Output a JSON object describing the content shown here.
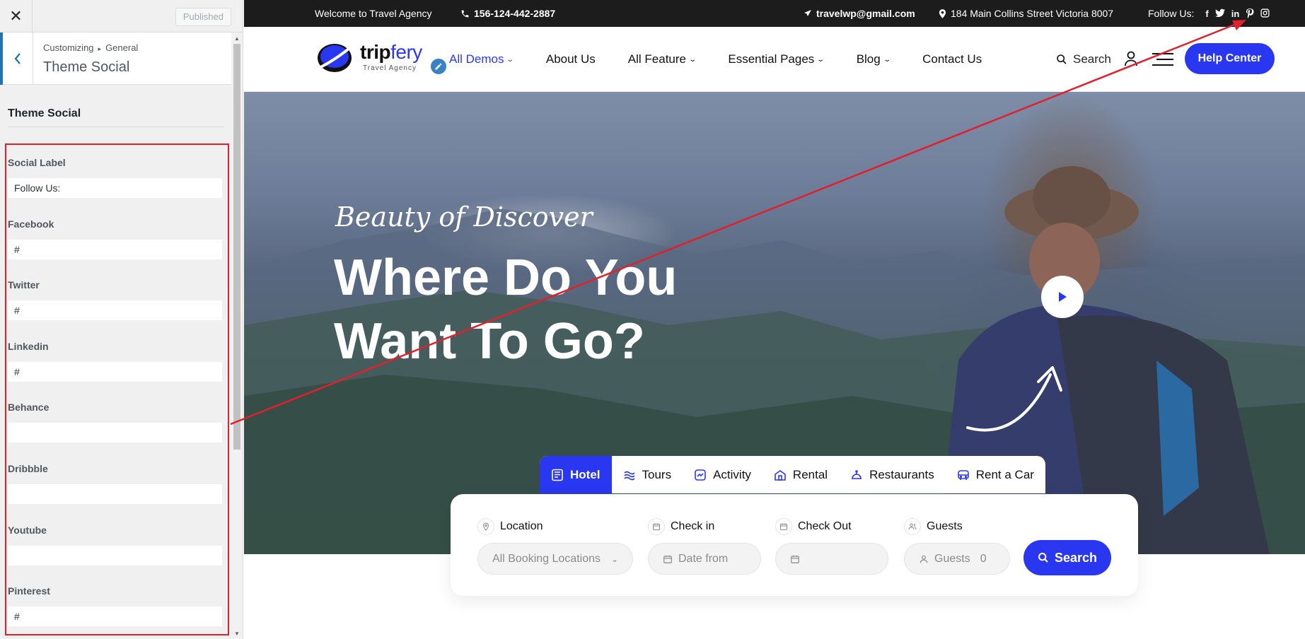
{
  "customizer": {
    "close_label": "✕",
    "published_label": "Published",
    "breadcrumb_root": "Customizing",
    "breadcrumb_sep": "▸",
    "breadcrumb_parent": "General",
    "section_title": "Theme Social",
    "panel_heading": "Theme Social",
    "fields": [
      {
        "label": "Social Label",
        "value": "Follow Us:"
      },
      {
        "label": "Facebook",
        "value": "#"
      },
      {
        "label": "Twitter",
        "value": "#"
      },
      {
        "label": "Linkedin",
        "value": "#"
      },
      {
        "label": "Behance",
        "value": ""
      },
      {
        "label": "Dribbble",
        "value": ""
      },
      {
        "label": "Youtube",
        "value": ""
      },
      {
        "label": "Pinterest",
        "value": "#"
      }
    ]
  },
  "topbar": {
    "welcome": "Welcome to Travel Agency",
    "phone": "156-124-442-2887",
    "email": "travelwp@gmail.com",
    "address": "184 Main Collins Street Victoria 8007",
    "follow_label": "Follow Us:",
    "social": [
      "facebook-icon",
      "twitter-icon",
      "linkedin-icon",
      "pinterest-icon",
      "instagram-icon"
    ]
  },
  "nav": {
    "logo_name_1": "trip",
    "logo_name_2": "fery",
    "logo_tagline": "Travel Agency",
    "items": [
      {
        "label": "All Demos",
        "dropdown": true,
        "active": true
      },
      {
        "label": "About Us",
        "dropdown": false
      },
      {
        "label": "All Feature",
        "dropdown": true
      },
      {
        "label": "Essential Pages",
        "dropdown": true
      },
      {
        "label": "Blog",
        "dropdown": true
      },
      {
        "label": "Contact Us",
        "dropdown": false
      }
    ],
    "search_label": "Search",
    "help_label": "Help Center"
  },
  "hero": {
    "subtitle": "Beauty of Discover",
    "title_line1": "Where Do You",
    "title_line2": "Want To Go?"
  },
  "booking": {
    "tabs": [
      {
        "label": "Hotel",
        "active": true
      },
      {
        "label": "Tours"
      },
      {
        "label": "Activity"
      },
      {
        "label": "Rental"
      },
      {
        "label": "Restaurants"
      },
      {
        "label": "Rent a Car"
      }
    ],
    "location_label": "Location",
    "location_value": "All Booking Locations",
    "checkin_label": "Check in",
    "checkin_placeholder": "Date from",
    "checkout_label": "Check Out",
    "checkout_placeholder": "",
    "guests_label": "Guests",
    "guests_placeholder": "Guests",
    "guests_value": "0",
    "search_label": "Search"
  },
  "colors": {
    "brand": "#2a37f0",
    "annotation": "#e0202a",
    "topbar": "#1c1c1c"
  }
}
